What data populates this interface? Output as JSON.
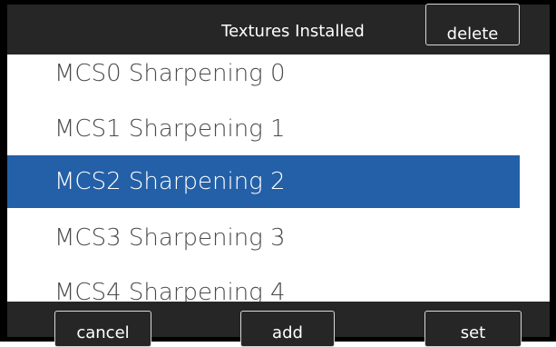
{
  "header": {
    "title": "Textures Installed",
    "delete_label": "delete"
  },
  "list": {
    "items": [
      {
        "label": "MCS0 Sharpening 0",
        "selected": false
      },
      {
        "label": "MCS1 Sharpening 1",
        "selected": false
      },
      {
        "label": "MCS2 Sharpening 2",
        "selected": true
      },
      {
        "label": "MCS3 Sharpening 3",
        "selected": false
      },
      {
        "label": "MCS4 Sharpening 4",
        "selected": false
      }
    ]
  },
  "footer": {
    "cancel_label": "cancel",
    "add_label": "add",
    "set_label": "set"
  },
  "colors": {
    "bar": "#262626",
    "selection": "#2460a7",
    "list_background": "#ffffff",
    "list_text": "#4a4a4a"
  }
}
